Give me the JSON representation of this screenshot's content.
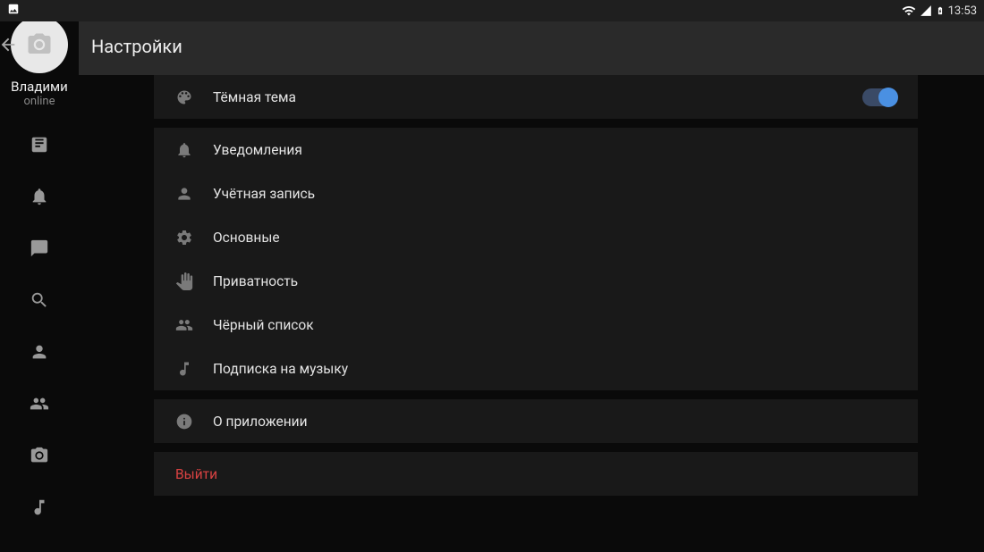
{
  "statusbar": {
    "time": "13:53"
  },
  "sidebar": {
    "username": "Владими",
    "status": "online"
  },
  "header": {
    "title": "Настройки"
  },
  "sections": {
    "theme": {
      "label": "Тёмная тема",
      "enabled": true
    },
    "general": {
      "notifications": "Уведомления",
      "account": "Учётная запись",
      "main": "Основные",
      "privacy": "Приватность",
      "blacklist": "Чёрный список",
      "music": "Подписка на музыку"
    },
    "about": {
      "label": "О приложении"
    },
    "logout": {
      "label": "Выйти"
    }
  },
  "colors": {
    "accent": "#4a90e2",
    "danger": "#d94242"
  }
}
